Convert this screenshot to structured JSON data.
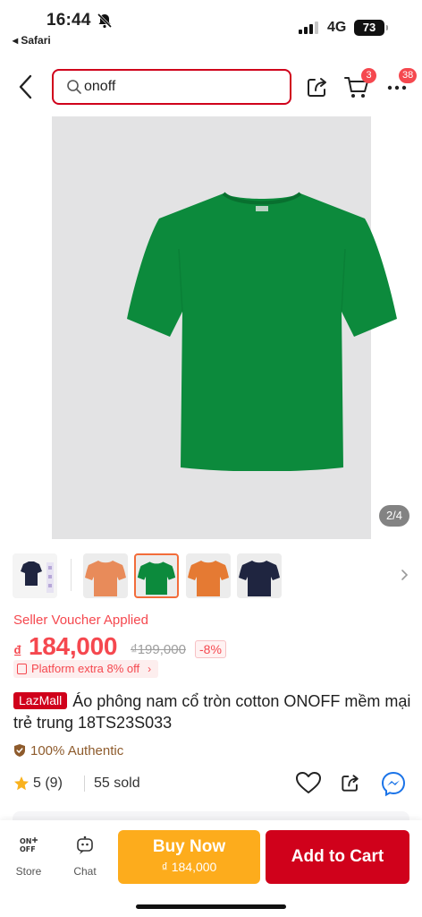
{
  "status_bar": {
    "time": "16:44",
    "back_app": "◂ Safari",
    "network": "4G",
    "battery": "73"
  },
  "search": {
    "value": "onoff"
  },
  "header": {
    "cart_badge": "3",
    "more_badge": "38"
  },
  "gallery": {
    "counter": "2/4",
    "product_color": "#0c8a3c"
  },
  "thumbnails": [
    {
      "color": "#1f2540",
      "label": "size-chart"
    },
    {
      "color": "#e88b5a"
    },
    {
      "color": "#0c8a3c",
      "selected": true
    },
    {
      "color": "#e57a33"
    },
    {
      "color": "#1f2540"
    }
  ],
  "voucher": "Seller Voucher Applied",
  "price": {
    "currency": "₫",
    "current": "184,000",
    "original": "₫199,000",
    "discount": "-8%"
  },
  "platform_offer": "Platform extra 8% off",
  "product": {
    "badge": "LazMall",
    "title": "Áo phông nam cổ tròn cotton ONOFF mềm mại trẻ trung 18TS23S033"
  },
  "authentic": "100% Authentic",
  "rating": {
    "text": "5 (9)",
    "sold": "55 sold"
  },
  "bottom_bar": {
    "store_label": "Store",
    "chat_label": "Chat",
    "buy_now_label": "Buy Now",
    "buy_now_price": "₫ 184,000",
    "add_to_cart_label": "Add to Cart"
  },
  "colors": {
    "accent": "#d0011b",
    "price": "#f5484f",
    "buy_now": "#fdac1c"
  }
}
